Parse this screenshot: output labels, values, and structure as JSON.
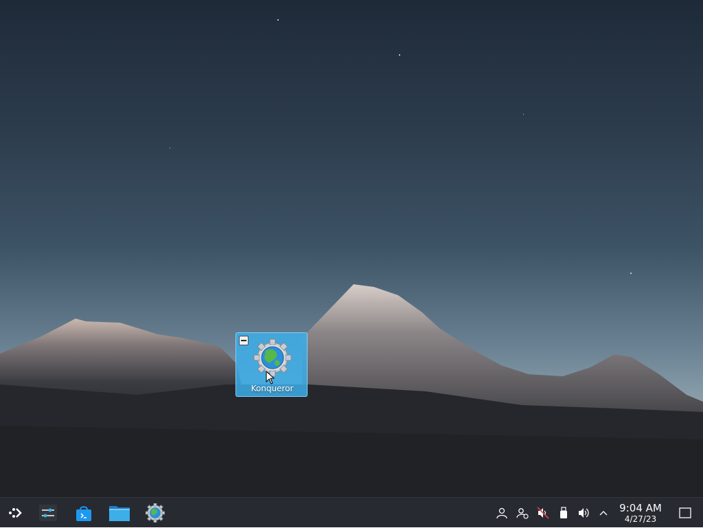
{
  "desktop": {
    "icons": [
      {
        "label": "Konqueror",
        "icon": "konqueror-icon",
        "selected": true
      }
    ]
  },
  "taskbar": {
    "launcher": {
      "icon": "application-launcher-icon"
    },
    "tasks": [
      {
        "icon": "system-settings-icon"
      },
      {
        "icon": "discover-icon"
      },
      {
        "icon": "dolphin-folder-icon"
      },
      {
        "icon": "konqueror-icon"
      }
    ],
    "tray": [
      {
        "icon": "user-icon"
      },
      {
        "icon": "user-status-icon"
      },
      {
        "icon": "volume-muted-icon"
      },
      {
        "icon": "usb-device-icon"
      },
      {
        "icon": "volume-icon"
      },
      {
        "icon": "chevron-up-icon"
      }
    ],
    "clock": {
      "time": "9:04 AM",
      "date": "4/27/23"
    },
    "show_desktop": {
      "icon": "show-desktop-icon"
    }
  },
  "colors": {
    "selection": "#3daee9",
    "panel": "#272b31",
    "panel_text": "#fcfcfc"
  }
}
